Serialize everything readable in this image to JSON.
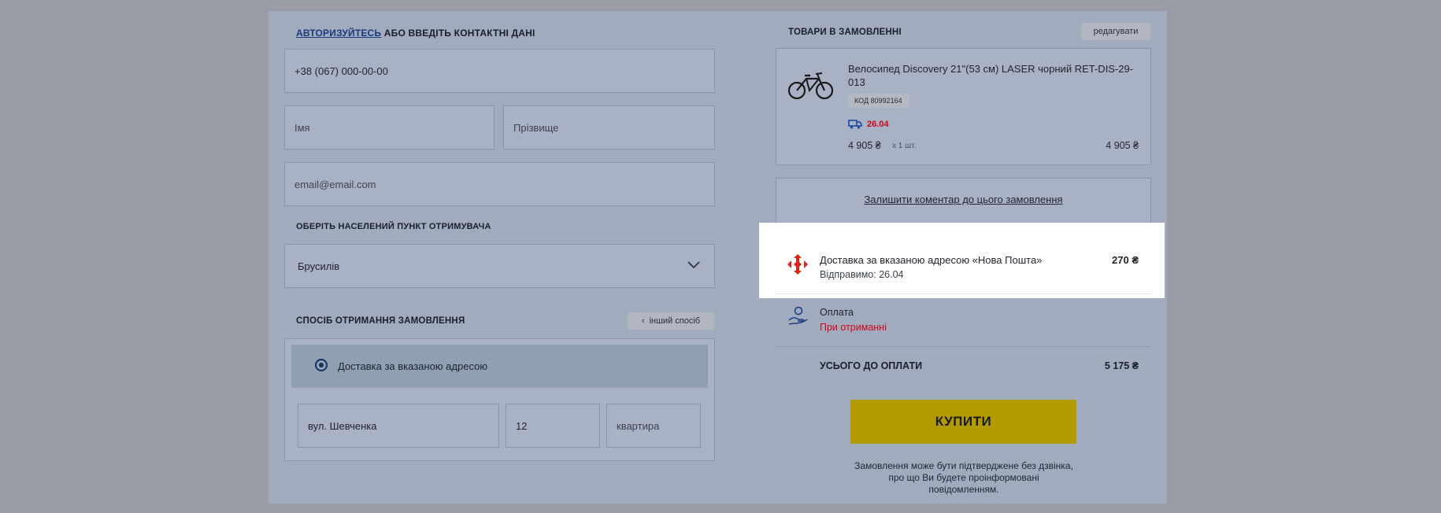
{
  "contact": {
    "login_link": "АВТОРИЗУЙТЕСЬ",
    "header_rest": "АБО ВВЕДІТЬ КОНТАКТНІ ДАНІ",
    "phone_value": "+38 (067) 000-00-00",
    "first_name_placeholder": "Імя",
    "last_name_placeholder": "Прізвище",
    "email_placeholder": "email@email.com"
  },
  "city": {
    "header": "ОБЕРІТЬ НАСЕЛЕНИЙ ПУНКТ ОТРИМУВАЧА",
    "selected": "Брусилів"
  },
  "delivery_method": {
    "header": "СПОСІБ ОТРИМАННЯ ЗАМОВЛЕННЯ",
    "other_button": "інший спосіб",
    "option_label": "Доставка за вказаною адресою",
    "street_value": "вул. Шевченка",
    "house_value": "12",
    "apartment_placeholder": "квартира"
  },
  "order": {
    "header": "ТОВАРИ В ЗАМОВЛЕННІ",
    "edit_button": "редагувати",
    "item": {
      "name_line1": "Велосипед Discovery 21\"(53 см) LASER чорний RET-DIS-29-",
      "name_line2": "013",
      "code": "КОД 80992164",
      "delivery_date": "26.04",
      "price": "4 905 ₴",
      "qty": "x 1 шт.",
      "total": "4 905 ₴"
    },
    "comment_link": "Залишити коментар до цього замовлення",
    "shipping": {
      "title": "Доставка за вказаною адресою «Нова Пошта»",
      "subtitle": "Відправимо: 26.04",
      "price": "270 ₴"
    },
    "payment": {
      "label": "Оплата",
      "value": "При отриманні"
    },
    "total_label": "УСЬОГО ДО ОПЛАТИ",
    "total_value": "5 175 ₴",
    "buy_button": "КУПИТИ",
    "note": "Замовлення може бути підтверджене без дзвінка, про що Ви будете проінформовані повідомленням."
  },
  "colors": {
    "accent_red": "#d0021b",
    "buy_yellow": "#b29a02",
    "brand_blue": "#163b7a"
  }
}
